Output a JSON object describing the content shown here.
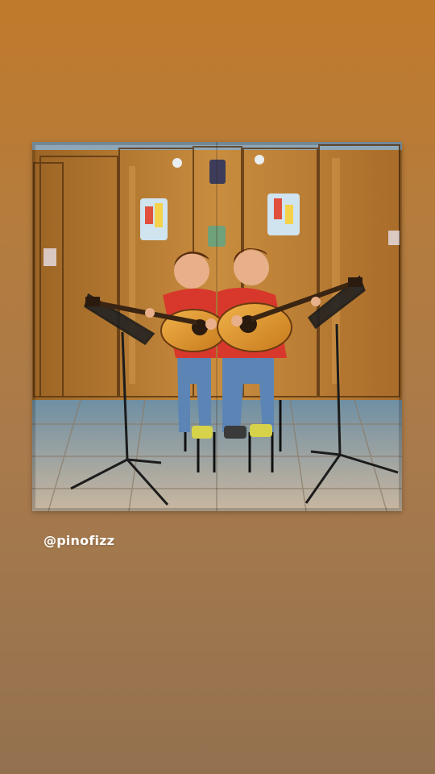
{
  "story": {
    "background_top": "#c07a2b",
    "background_bottom": "#93714f",
    "photo": {
      "subject": "mirrored-photo-boy-playing-guitar"
    },
    "mention": "@pinofizz"
  }
}
